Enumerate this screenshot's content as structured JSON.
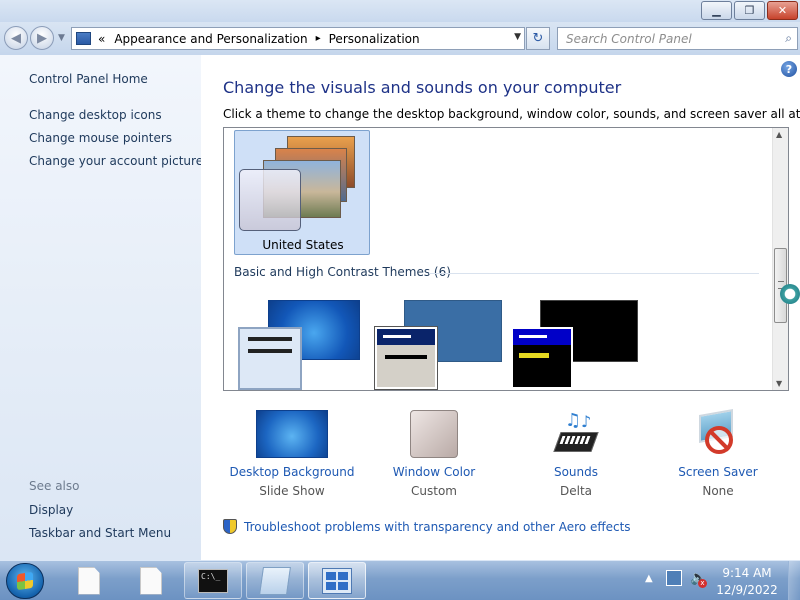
{
  "window": {
    "min_glyph": "▁",
    "max_glyph": "❐",
    "close_glyph": "✕"
  },
  "nav": {
    "back_glyph": "◀",
    "forward_glyph": "▶",
    "breadcrumb_start": "«",
    "breadcrumb": [
      "Appearance and Personalization",
      "Personalization"
    ],
    "crumb_separator": "▸",
    "dropdown_glyph": "▼",
    "refresh_glyph": "↻",
    "search_placeholder": "Search Control Panel"
  },
  "sidebar": {
    "home": "Control Panel Home",
    "links": [
      "Change desktop icons",
      "Change mouse pointers",
      "Change your account picture"
    ],
    "see_also_title": "See also",
    "see_also": [
      "Display",
      "Taskbar and Start Menu"
    ]
  },
  "main": {
    "help_glyph": "?",
    "heading": "Change the visuals and sounds on your computer",
    "subtext": "Click a theme to change the desktop background, window color, sounds, and screen saver all at once.",
    "selected_theme": "United States",
    "section_title": "Basic and High Contrast Themes (6)",
    "bottom_items": [
      {
        "label": "Desktop Background",
        "value": "Slide Show",
        "icon": "desktop-background-icon"
      },
      {
        "label": "Window Color",
        "value": "Custom",
        "icon": "window-color-icon"
      },
      {
        "label": "Sounds",
        "value": "Delta",
        "icon": "sounds-icon"
      },
      {
        "label": "Screen Saver",
        "value": "None",
        "icon": "screen-saver-icon"
      }
    ],
    "troubleshoot": "Troubleshoot problems with transparency and other Aero effects"
  },
  "taskbar": {
    "cmd_text": "C:\\_",
    "tray_arrow": "▲",
    "volume_glyph": "🔈",
    "mute_glyph": "x",
    "time": "9:14 AM",
    "date": "12/9/2022"
  },
  "colors": {
    "link": "#1e59b3",
    "heading": "#1e3287",
    "selected_theme_bg": "#cfe0f7"
  }
}
